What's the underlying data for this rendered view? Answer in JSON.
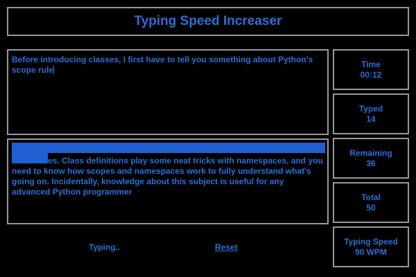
{
  "app": {
    "title": "Typing Speed Increaser"
  },
  "typed_area": {
    "text": "Before introducing classes, I first have to tell you something about Python's scope rule"
  },
  "source_area": {
    "text": "es. Class definitions play some neat tricks with namespaces, and you need to know how scopes and namespaces work to fully understand what's going on. Incidentally, knowledge about this subject is useful for any advanced Python programmer"
  },
  "stats": {
    "time": {
      "label": "Time",
      "value": "00:12"
    },
    "typed": {
      "label": "Typed",
      "value": "14"
    },
    "remaining": {
      "label": "Remaining",
      "value": "36"
    },
    "total": {
      "label": "Total",
      "value": "50"
    },
    "speed": {
      "label": "Typing Speed",
      "value": "90 WPM"
    }
  },
  "footer": {
    "status": "Typing..",
    "reset_label": "Reset"
  },
  "colors": {
    "background": "#000000",
    "text": "#2a6fd6",
    "border": "#9a9a9a",
    "highlight": "#1f5fd1"
  }
}
